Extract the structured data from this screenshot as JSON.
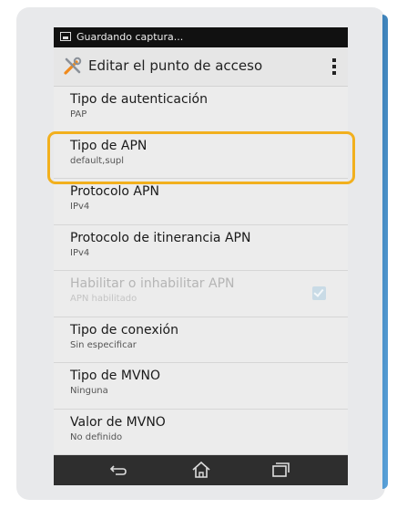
{
  "status_bar": {
    "text": "Guardando captura..."
  },
  "action_bar": {
    "title": "Editar el punto de acceso"
  },
  "settings": [
    {
      "title": "Tipo de autenticación",
      "value": "PAP"
    },
    {
      "title": "Tipo de APN",
      "value": "default,supl"
    },
    {
      "title": "Protocolo APN",
      "value": "IPv4"
    },
    {
      "title": "Protocolo de itinerancia APN",
      "value": "IPv4"
    },
    {
      "title": "Habilitar o inhabilitar APN",
      "value": "APN habilitado",
      "enabled": false,
      "checked": true
    },
    {
      "title": "Tipo de conexión",
      "value": "Sin especificar"
    },
    {
      "title": "Tipo de MVNO",
      "value": "Ninguna"
    },
    {
      "title": "Valor de MVNO",
      "value": "No definido"
    }
  ],
  "nav_bar": {
    "buttons": [
      "back-icon",
      "home-icon",
      "recents-icon"
    ]
  },
  "colors": {
    "highlight": "#f2b01e",
    "status_bar": "#111111",
    "nav_bar": "#2e2e2e"
  }
}
